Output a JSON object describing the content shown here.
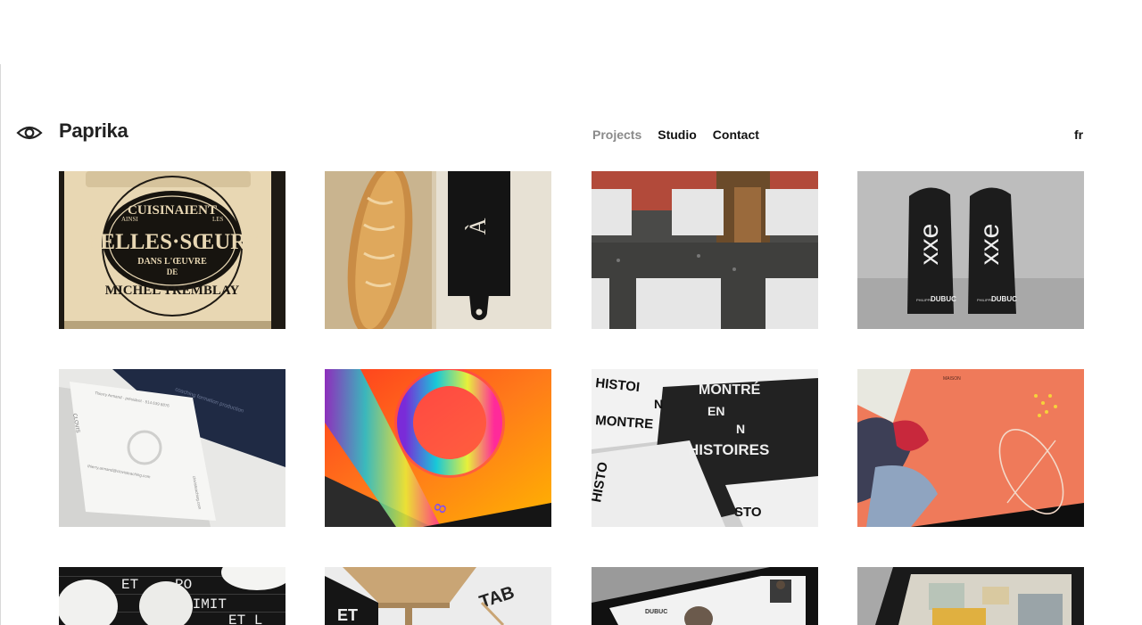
{
  "header": {
    "brand": "Paprika",
    "logo_icon": "eye-icon",
    "nav": [
      {
        "label": "Projects",
        "active": true
      },
      {
        "label": "Studio",
        "active": false
      },
      {
        "label": "Contact",
        "active": false
      }
    ],
    "lang": "fr"
  },
  "projects": [
    {
      "image": "belles-soeurs-book",
      "text": {
        "top": "CUISINAIENT",
        "mid": "BELLES·SŒURS",
        "sub": "DANS L'ŒUVRE",
        "de": "DE",
        "bottom": "MICHEL TREMBLAY",
        "tiny_left": "AINSI",
        "tiny_right": "LES"
      }
    },
    {
      "image": "bread-cutting-board",
      "text": {
        "board": "À"
      }
    },
    {
      "image": "street-grid-photo",
      "text": {}
    },
    {
      "image": "dubuc-bags",
      "text": {
        "bag_mark": "xxe",
        "bag_label": "DUBUC",
        "bag_small": "PHILIPPE"
      }
    },
    {
      "image": "clovis-business-card",
      "text": {
        "brand": "CLOVIS",
        "name": "Thierry Armand · président · 514 639 8876",
        "email": "thierry.armand@clovisteaching.com",
        "web": "clovisteaching.com",
        "back": "coaching   formation   production"
      }
    },
    {
      "image": "colorful-book-8",
      "text": {
        "spine": "8"
      }
    },
    {
      "image": "montreal-histoires-print",
      "text": {
        "l1": "HISTOI",
        "l2": "MONTRÉ",
        "l3": "N",
        "l4": "EN",
        "l5": "N",
        "l6": "MONTRE",
        "l7": "HISTOIRES",
        "l8": "HISTO",
        "l9": "STO"
      }
    },
    {
      "image": "maison-abstract-print",
      "text": {
        "corner": "MAISON"
      }
    },
    {
      "image": "lamps-letterboard",
      "text": {
        "a": "ET",
        "b": "PO",
        "c": "LIMIT",
        "d": "ET L"
      }
    },
    {
      "image": "wooden-table-tab",
      "text": {
        "a": "TAB",
        "b": "ET"
      }
    },
    {
      "image": "dubuc-website-tablet",
      "text": {
        "mini": "DUBUC"
      }
    },
    {
      "image": "tablet-interior",
      "text": {}
    }
  ]
}
